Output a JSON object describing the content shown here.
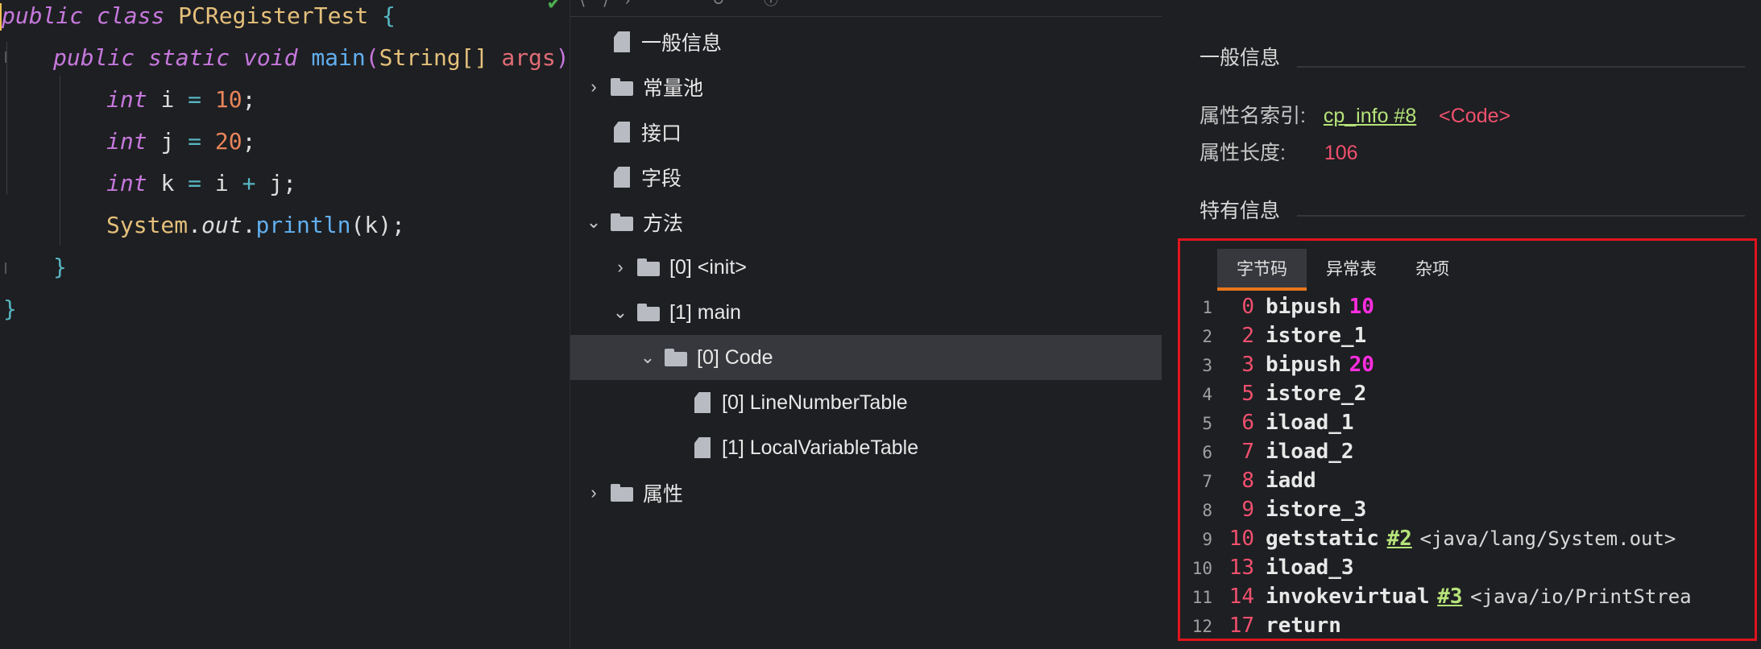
{
  "editor": {
    "lines": [
      {
        "kw1": "public",
        "kw2": "class",
        "name": "PCRegisterTest",
        "brace": "{"
      },
      {
        "kw1": "public",
        "kw2": "static",
        "kw3": "void",
        "fn": "main",
        "open": "(",
        "type": "String[]",
        "param": "args",
        "close": ")",
        "brace": "{"
      },
      {
        "type": "int",
        "var": "i",
        "eq": "=",
        "num": "10",
        "semi": ";"
      },
      {
        "type": "int",
        "var": "j",
        "eq": "=",
        "num": "20",
        "semi": ";"
      },
      {
        "type": "int",
        "var": "k",
        "eq": "=",
        "a": "i",
        "plus": "+",
        "b": "j",
        "semi": ";"
      },
      {
        "cls": "System",
        "dot1": ".",
        "field": "out",
        "dot2": ".",
        "fn": "println",
        "open": "(",
        "arg": "k",
        "close": ")",
        "semi": ";"
      },
      {
        "brace": "}"
      },
      {
        "brace": "}"
      }
    ]
  },
  "tree": {
    "items": [
      {
        "label": "一般信息"
      },
      {
        "label": "常量池"
      },
      {
        "label": "接口"
      },
      {
        "label": "字段"
      },
      {
        "label": "方法"
      },
      {
        "label": "[0] <init>"
      },
      {
        "label": "[1] main"
      },
      {
        "label": "[0] Code"
      },
      {
        "label": "[0] LineNumberTable"
      },
      {
        "label": "[1] LocalVariableTable"
      },
      {
        "label": "属性"
      }
    ]
  },
  "info": {
    "general_title": "一般信息",
    "attr_name_index_label": "属性名索引:",
    "attr_name_index_link": "cp_info #8",
    "attr_name_index_value": "<Code>",
    "attr_length_label": "属性长度:",
    "attr_length_value": "106",
    "specific_title": "特有信息",
    "tabs": [
      "字节码",
      "异常表",
      "杂项"
    ],
    "bytecode": [
      {
        "line": "1",
        "offset": "0",
        "op": "bipush",
        "arg": "10"
      },
      {
        "line": "2",
        "offset": "2",
        "op": "istore_1"
      },
      {
        "line": "3",
        "offset": "3",
        "op": "bipush",
        "arg": "20"
      },
      {
        "line": "4",
        "offset": "5",
        "op": "istore_2"
      },
      {
        "line": "5",
        "offset": "6",
        "op": "iload_1"
      },
      {
        "line": "6",
        "offset": "7",
        "op": "iload_2"
      },
      {
        "line": "7",
        "offset": "8",
        "op": "iadd"
      },
      {
        "line": "8",
        "offset": "9",
        "op": "istore_3"
      },
      {
        "line": "9",
        "offset": "10",
        "op": "getstatic",
        "ref": "#2",
        "comment": "<java/lang/System.out>"
      },
      {
        "line": "10",
        "offset": "13",
        "op": "iload_3"
      },
      {
        "line": "11",
        "offset": "14",
        "op": "invokevirtual",
        "ref": "#3",
        "comment": "<java/io/PrintStrea"
      },
      {
        "line": "12",
        "offset": "17",
        "op": "return"
      }
    ]
  },
  "colors": {
    "background": "#1e1f22",
    "highlight_border": "#e0141e",
    "active_tab_underline": "#e8761a",
    "offset": "#f0506e",
    "link": "#b5e37a",
    "immediate": "#ff2de0"
  }
}
